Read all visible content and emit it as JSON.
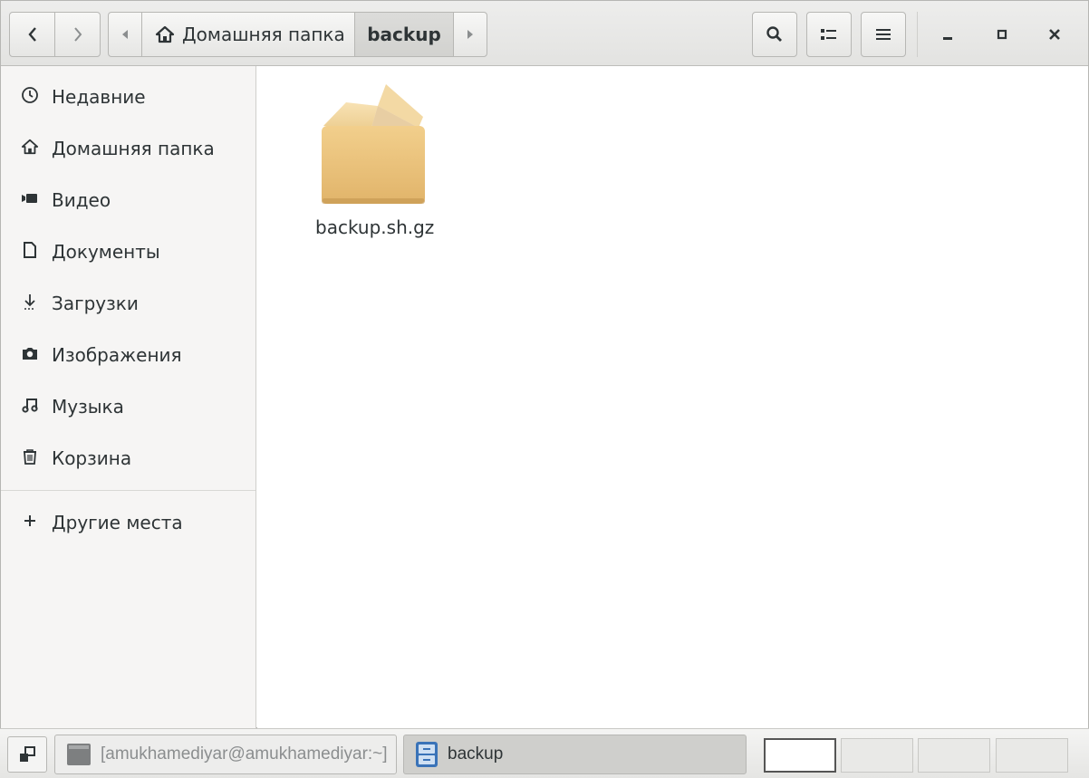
{
  "headerbar": {
    "back_icon": "chevron-left-icon",
    "forward_icon": "chevron-right-icon",
    "path": {
      "home_label": "Домашняя папка",
      "current_label": "backup"
    },
    "tools": {
      "search_icon": "search-icon",
      "view_icon": "list-view-icon",
      "menu_icon": "hamburger-menu-icon"
    },
    "window_controls": {
      "minimize_icon": "minimize-icon",
      "maximize_icon": "maximize-icon",
      "close_icon": "close-icon"
    }
  },
  "sidebar": {
    "items": [
      {
        "label": "Недавние",
        "icon": "clock-icon"
      },
      {
        "label": "Домашняя папка",
        "icon": "home-icon"
      },
      {
        "label": "Видео",
        "icon": "video-icon"
      },
      {
        "label": "Документы",
        "icon": "document-icon"
      },
      {
        "label": "Загрузки",
        "icon": "download-icon"
      },
      {
        "label": "Изображения",
        "icon": "camera-icon"
      },
      {
        "label": "Музыка",
        "icon": "music-icon"
      },
      {
        "label": "Корзина",
        "icon": "trash-icon"
      }
    ],
    "other_places": {
      "label": "Другие места",
      "icon": "plus-icon"
    }
  },
  "content": {
    "files": [
      {
        "name": "backup.sh.gz",
        "icon": "archive-box-icon"
      }
    ]
  },
  "taskbar": {
    "show_desktop_icon": "show-desktop-icon",
    "tasks": [
      {
        "label": "[amukhamediyar@amukhamediyar:~]",
        "icon": "terminal-icon"
      },
      {
        "label": "backup",
        "icon": "file-manager-icon"
      }
    ]
  }
}
